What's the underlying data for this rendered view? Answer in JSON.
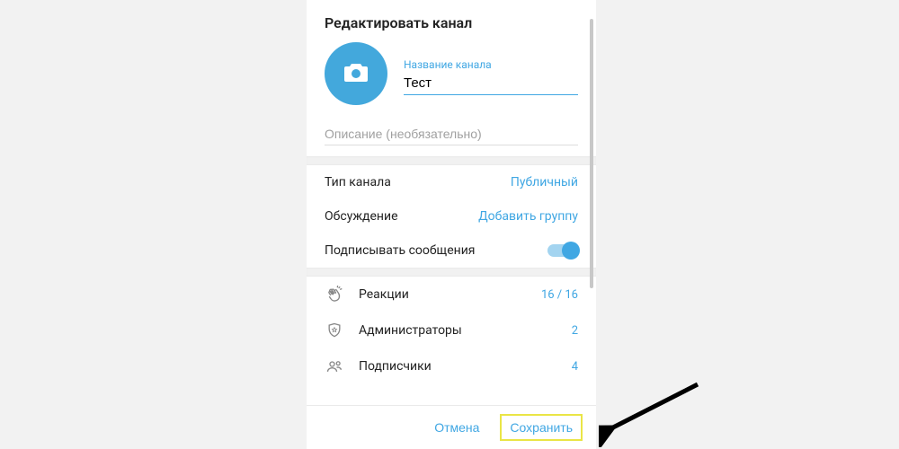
{
  "dialog": {
    "title": "Редактировать канал",
    "name": {
      "label": "Название канала",
      "value": "Тест"
    },
    "description": {
      "placeholder": "Описание (необязательно)",
      "value": ""
    },
    "settings": {
      "type": {
        "label": "Тип канала",
        "value": "Публичный"
      },
      "discussion": {
        "label": "Обсуждение",
        "value": "Добавить группу"
      },
      "sign": {
        "label": "Подписывать сообщения",
        "on": true
      }
    },
    "management": {
      "reactions": {
        "label": "Реакции",
        "count": "16 / 16"
      },
      "admins": {
        "label": "Администраторы",
        "count": "2"
      },
      "subscribers": {
        "label": "Подписчики",
        "count": "4"
      }
    },
    "buttons": {
      "cancel": "Отмена",
      "save": "Сохранить"
    }
  },
  "colors": {
    "accent": "#40a7e3"
  }
}
